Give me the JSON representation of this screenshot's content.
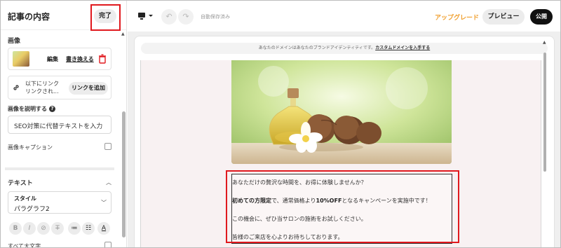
{
  "panel": {
    "title": "記事の内容",
    "done_label": "完了",
    "image_section": {
      "label": "画像",
      "edit_label": "編集",
      "replace_label": "書き換える"
    },
    "link_section": {
      "text": "以下にリンク リンクされ...",
      "add_link_label": "リンクを追加"
    },
    "alt_section": {
      "label": "画像を説明する",
      "help_icon": "?",
      "placeholder": "SEO対策に代替テキストを入力"
    },
    "caption_label": "画像キャプション",
    "text_section": {
      "label": "テキスト",
      "style_label": "スタイル",
      "style_value": "パラグラフ2"
    },
    "format_buttons": [
      "B",
      "I",
      "⊘",
      "T",
      "≔",
      "☷",
      "A"
    ],
    "allcaps_label": "すべて大文字"
  },
  "toolbar": {
    "autosave_label": "自動保存済み",
    "upgrade_label": "アップグレード",
    "preview_label": "プレビュー",
    "publish_label": "公開"
  },
  "canvas": {
    "domain_notice": "あなたのドメインはあなたのブランドアイデンティティです。",
    "domain_link": "カスタムドメインを入手する",
    "text_lines": {
      "line1": "あなただけの贅沢な時間を、お得に体験しませんか？",
      "line2_bold_a": "初めての方限定",
      "line2_mid": "で、通常価格より",
      "line2_bold_b": "10%OFF",
      "line2_end": "となるキャンペーンを実施中です！",
      "line3": "この機会に、ぜひ当サロンの施術をお試しください。",
      "line4": "皆様のご来店を心よりお待ちしております。"
    }
  },
  "colors": {
    "highlight_red": "#e0191e",
    "upgrade_orange": "#f0a030",
    "publish_black": "#111111",
    "page_pink": "#f8f1f2"
  },
  "icons": {
    "trash": "trash-icon",
    "link": "link-icon",
    "device": "desktop-icon",
    "undo": "undo-icon",
    "redo": "redo-icon"
  }
}
